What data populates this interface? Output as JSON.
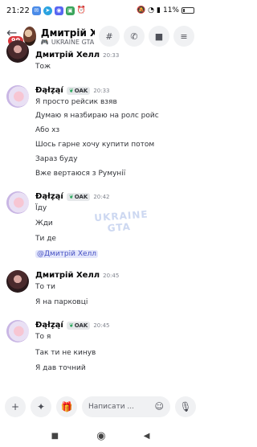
{
  "status_bar": {
    "time": "21:22",
    "battery": "11%",
    "notification_icons": [
      "chat-bubble-icon",
      "telegram-icon",
      "discord-icon",
      "photo-icon",
      "alarm-icon"
    ],
    "system_icons": [
      "mute-icon",
      "wifi-icon",
      "signal-icon",
      "battery-icon"
    ]
  },
  "header": {
    "unread_badge": "99",
    "contact_name": "Дмитрій Х...",
    "activity": "UKRAINE GTA",
    "buttons": [
      "threads-icon",
      "phone-icon",
      "video-icon",
      "menu-icon"
    ]
  },
  "messages": [
    {
      "author": "Дмитрій Хелл",
      "time": "20:33",
      "avatar": "dima",
      "lines": [
        "Тож"
      ]
    },
    {
      "author": "Ɖąłẓąí",
      "tag": "OAK",
      "time": "20:33",
      "avatar": "dalzai",
      "lines": [
        "Я просто рейсик взяв",
        "Думаю я назбираю на ролс ройс",
        "Або хз",
        "Шось гарне хочу купити потом",
        "Зараз буду",
        "Вже вертаюся з Румунії"
      ]
    },
    {
      "author": "Ɖąłẓąí",
      "tag": "OAK",
      "time": "20:42",
      "avatar": "dalzai",
      "lines": [
        "Їду",
        "Жди",
        "Ти де",
        "@Дмитрій Хелл"
      ]
    },
    {
      "author": "Дмитрій Хелл",
      "time": "20:45",
      "avatar": "dima",
      "lines": [
        "То ти",
        "Я на парковці"
      ]
    },
    {
      "author": "Ɖąłẓąí",
      "tag": "OAK",
      "time": "20:45",
      "avatar": "dalzai",
      "lines": [
        "То я",
        "Так ти не кинув",
        "Я дав точний"
      ]
    }
  ],
  "watermark": {
    "line1": "UKRAINE",
    "line2": "GTA"
  },
  "composer": {
    "placeholder": "Написати ..."
  },
  "nav": [
    "recents-icon",
    "home-icon",
    "back-icon"
  ],
  "colors": {
    "mention_bg": "#e3e6fb",
    "mention_text": "#4752c4",
    "badge": "#da373c",
    "accent": "#5865f2"
  }
}
